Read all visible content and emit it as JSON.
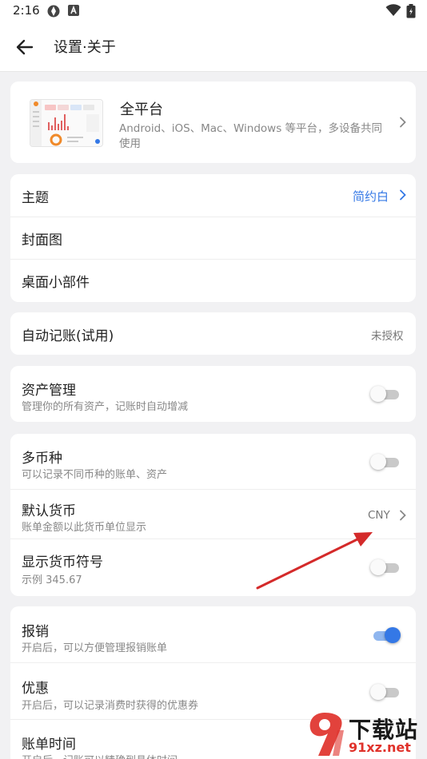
{
  "status_bar": {
    "time": "2:16",
    "icons": [
      "sync-icon",
      "a-badge-icon",
      "wifi-icon",
      "battery-icon"
    ]
  },
  "app_bar": {
    "title": "设置·关于",
    "back_icon": "arrow-left-icon"
  },
  "platform_card": {
    "title": "全平台",
    "subtitle_line1": "Android、iOS、Mac、Windows 等平台，多设备共同",
    "subtitle_line2": "使用"
  },
  "appearance": {
    "theme_label": "主题",
    "theme_value": "简约白",
    "cover_label": "封面图",
    "widget_label": "桌面小部件"
  },
  "auto_bookkeeping": {
    "label": "自动记账(试用)",
    "value": "未授权"
  },
  "asset": {
    "label": "资产管理",
    "sub": "管理你的所有资产，记账时自动增减",
    "enabled": false
  },
  "currency": {
    "multi_label": "多币种",
    "multi_sub": "可以记录不同币种的账单、资产",
    "multi_enabled": false,
    "default_label": "默认货币",
    "default_sub": "账单金额以此货币单位显示",
    "default_value": "CNY",
    "symbol_label": "显示货币符号",
    "symbol_sub": "示例 345.67",
    "symbol_enabled": false
  },
  "extras": {
    "reimburse_label": "报销",
    "reimburse_sub": "开启后，可以方便管理报销账单",
    "reimburse_enabled": true,
    "coupon_label": "优惠",
    "coupon_sub": "开启后，可以记录消费时获得的优惠券",
    "coupon_enabled": false,
    "billtime_label": "账单时间",
    "billtime_sub": "开启后，记账可以精确到具体时间"
  },
  "watermark": {
    "text": "下载站",
    "url": "91xz.net"
  },
  "colors": {
    "accent": "#3478e6",
    "arrow": "#d42a2a",
    "background": "#f1f1f3"
  }
}
